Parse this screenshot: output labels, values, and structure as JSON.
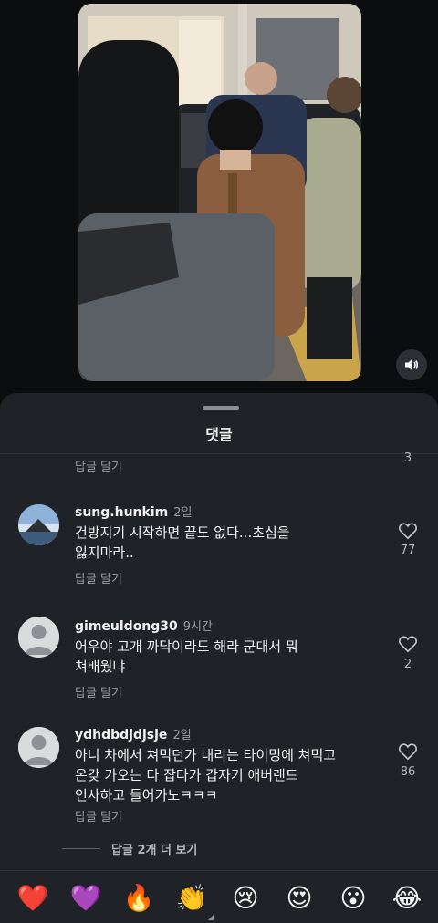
{
  "sheet": {
    "title": "댓글",
    "top_reply_label": "답글 달기",
    "top_like_count": "3",
    "more_replies": "답글 2개 더 보기"
  },
  "comments": [
    {
      "username": "sung.hunkim",
      "time": "2일",
      "text_lines": [
        "건방지기 시작하면 끝도 없다...초심을",
        "잃지마라.."
      ],
      "reply_label": "답글 달기",
      "likes": "77",
      "avatar": "landscape-photo"
    },
    {
      "username": "gimeuldong30",
      "time": "9시간",
      "text_lines": [
        "어우야 고개 까닥이라도 해라 군대서 뭐",
        "쳐배웠냐"
      ],
      "reply_label": "답글 달기",
      "likes": "2",
      "avatar": "default-person"
    },
    {
      "username": "ydhdbdjdjsje",
      "time": "2일",
      "text_lines": [
        "아니 차에서 쳐먹던가 내리는 타이밍에 쳐먹고",
        "온갖 가오는 다 잡다가 갑자기 애버랜드",
        "인사하고 들어가노ㅋㅋㅋ"
      ],
      "reply_label": "답글 달기",
      "likes": "86",
      "avatar": "default-person"
    }
  ],
  "reactions": [
    "❤️",
    "💜",
    "🔥",
    "👏",
    "😢",
    "😍",
    "😮",
    "😂"
  ],
  "icons": {
    "mute": "speaker-icon",
    "like": "heart-outline-icon"
  }
}
